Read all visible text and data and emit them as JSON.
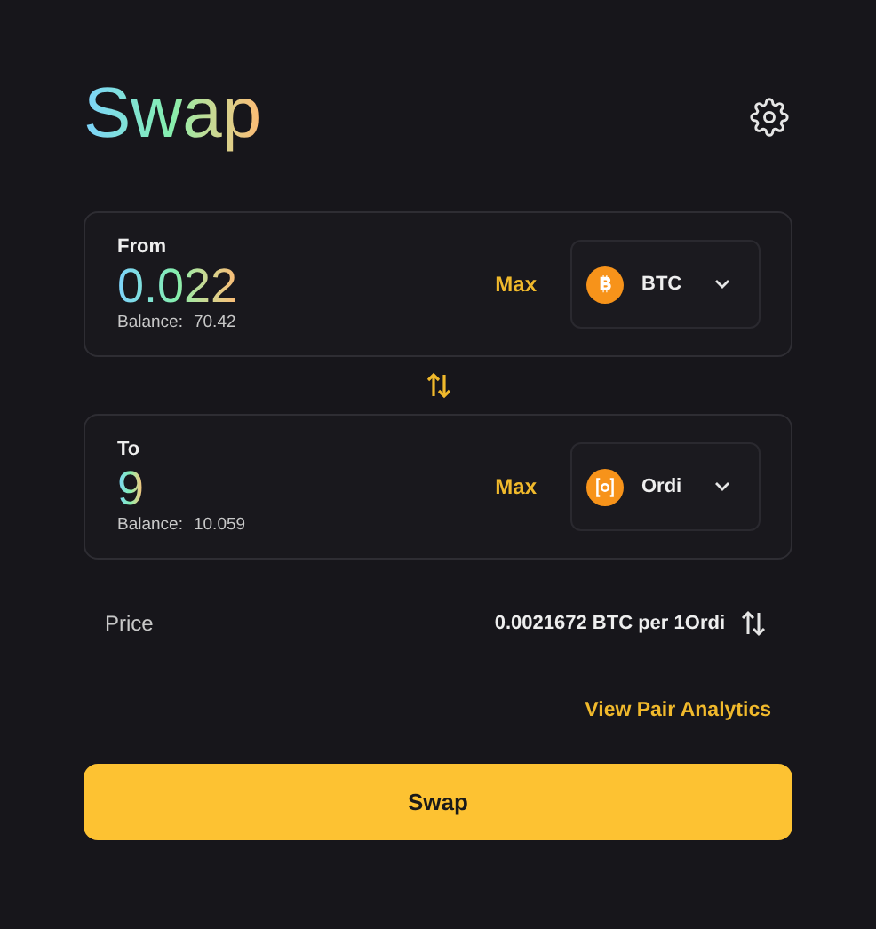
{
  "title": "Swap",
  "panels": [
    {
      "label": "From",
      "amount": "0.022",
      "balance_label": "Balance:",
      "balance": "70.42",
      "max": "Max",
      "token": {
        "symbol": "BTC",
        "kind": "btc"
      }
    },
    {
      "label": "To",
      "amount": "9",
      "balance_label": "Balance:",
      "balance": "10.059",
      "max": "Max",
      "token": {
        "symbol": "Ordi",
        "kind": "ordi"
      }
    }
  ],
  "price": {
    "label": "Price",
    "value": "0.0021672 BTC per 1Ordi"
  },
  "analytics_link": "View Pair Analytics",
  "swap_button": "Swap"
}
